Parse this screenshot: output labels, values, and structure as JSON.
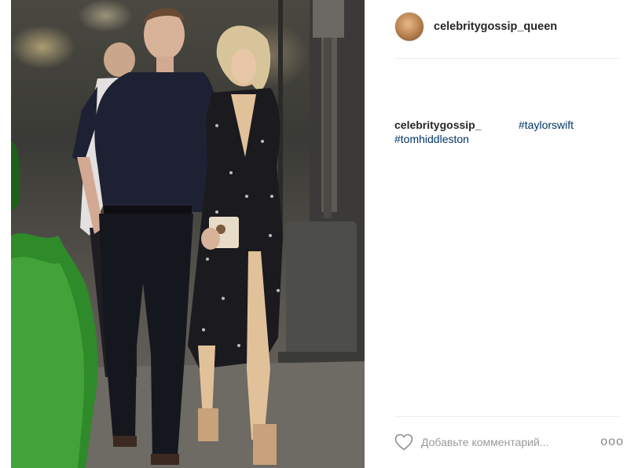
{
  "post": {
    "author": "celebritygossip_queen",
    "caption_user": "celebritygossip_",
    "hashtags": [
      "#taylorswift",
      "#tomhiddleston"
    ],
    "comment_placeholder": "Добавьте комментарий...",
    "more_glyph": "ooo"
  },
  "icons": {
    "like": "heart-icon",
    "more": "more-options-icon",
    "avatar": "profile-avatar"
  },
  "colors": {
    "hashtag": "#003569",
    "username": "#262626",
    "placeholder": "#9a9a9a",
    "divider": "#efefef"
  }
}
